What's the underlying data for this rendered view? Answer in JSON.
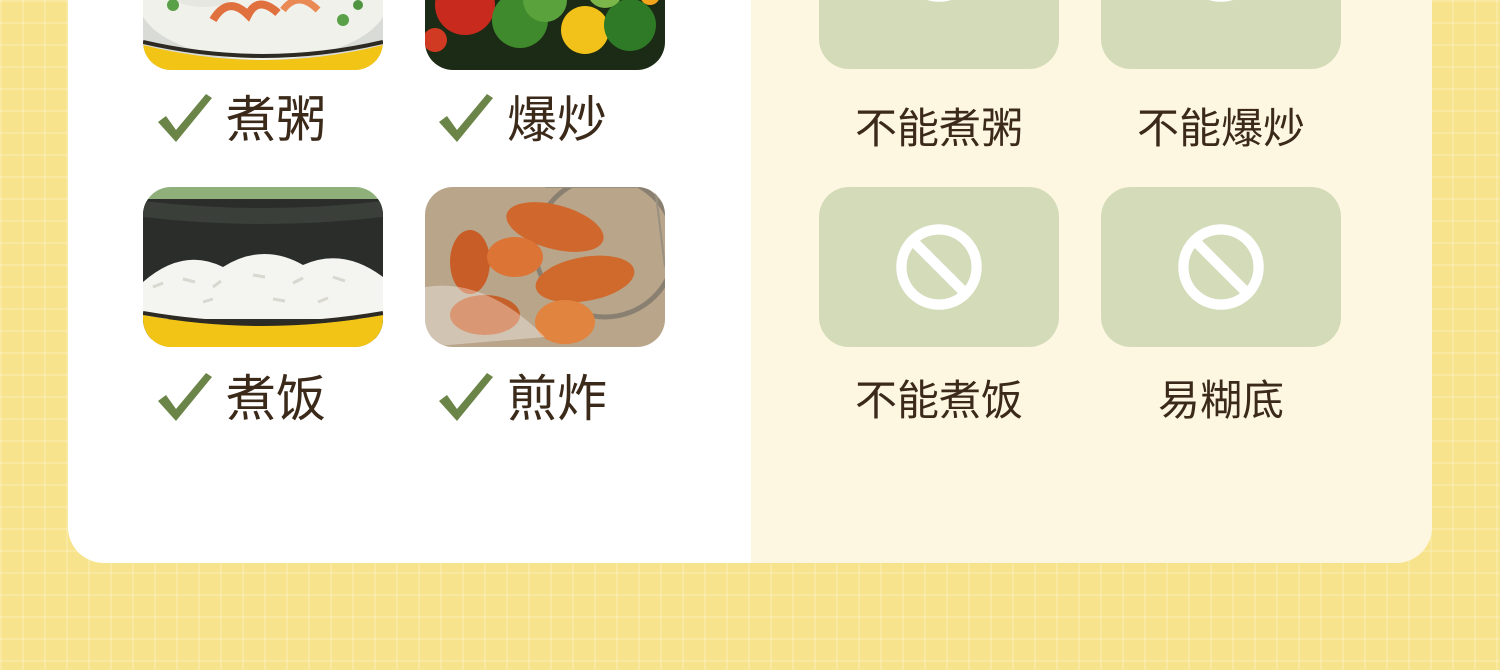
{
  "can_do": {
    "items": [
      {
        "label": "煮粥",
        "icon": "porridge-photo"
      },
      {
        "label": "爆炒",
        "icon": "stir-fry-photo"
      },
      {
        "label": "煮饭",
        "icon": "rice-photo"
      },
      {
        "label": "煎炸",
        "icon": "fried-chicken-photo"
      }
    ],
    "check_color": "#6b8548"
  },
  "cannot_do": {
    "items": [
      {
        "label": "不能煮粥",
        "icon": "ban-icon"
      },
      {
        "label": "不能爆炒",
        "icon": "ban-icon"
      },
      {
        "label": "不能煮饭",
        "icon": "ban-icon"
      },
      {
        "label": "易糊底",
        "icon": "ban-icon"
      }
    ],
    "tile_color": "#d3dbb9"
  },
  "colors": {
    "background": "#f6e38b",
    "left_panel": "#ffffff",
    "right_panel": "#fdf7e1",
    "text": "#3b2a1a"
  }
}
